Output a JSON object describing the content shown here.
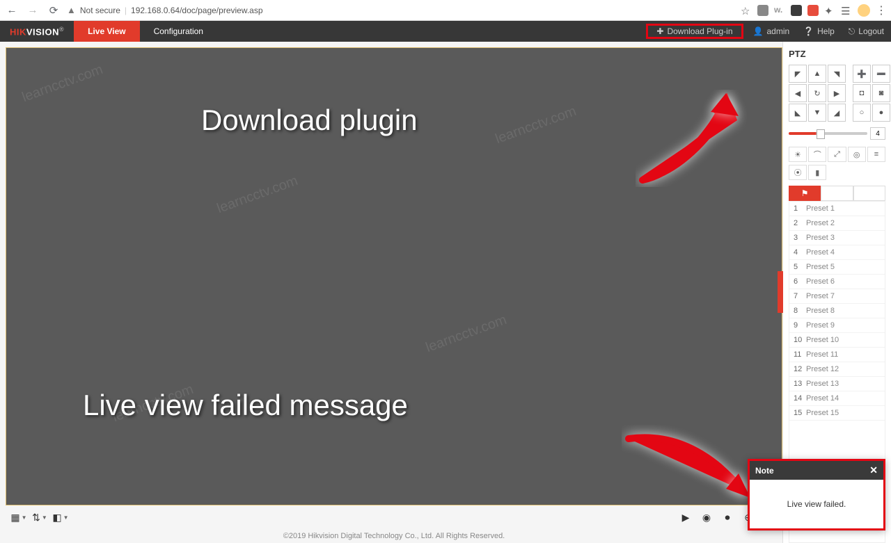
{
  "browser": {
    "security_label": "Not secure",
    "url": "192.168.0.64/doc/page/preview.asp"
  },
  "brand": {
    "part1": "HIK",
    "part2": "VISION",
    "reg": "®"
  },
  "nav": {
    "live_view": "Live View",
    "configuration": "Configuration"
  },
  "top_links": {
    "download": "Download Plug-in",
    "admin": "admin",
    "help": "Help",
    "logout": "Logout"
  },
  "ptz": {
    "title": "PTZ",
    "speed": "4",
    "presets": [
      {
        "n": "1",
        "name": "Preset 1"
      },
      {
        "n": "2",
        "name": "Preset 2"
      },
      {
        "n": "3",
        "name": "Preset 3"
      },
      {
        "n": "4",
        "name": "Preset 4"
      },
      {
        "n": "5",
        "name": "Preset 5"
      },
      {
        "n": "6",
        "name": "Preset 6"
      },
      {
        "n": "7",
        "name": "Preset 7"
      },
      {
        "n": "8",
        "name": "Preset 8"
      },
      {
        "n": "9",
        "name": "Preset 9"
      },
      {
        "n": "10",
        "name": "Preset 10"
      },
      {
        "n": "11",
        "name": "Preset 11"
      },
      {
        "n": "12",
        "name": "Preset 12"
      },
      {
        "n": "13",
        "name": "Preset 13"
      },
      {
        "n": "14",
        "name": "Preset 14"
      },
      {
        "n": "15",
        "name": "Preset 15"
      }
    ]
  },
  "annotations": {
    "download_plugin": "Download plugin",
    "live_view_failed_message": "Live view failed message"
  },
  "note": {
    "title": "Note",
    "body": "Live view failed."
  },
  "footer": "©2019 Hikvision Digital Technology Co., Ltd. All Rights Reserved.",
  "watermark": "learncctv.com"
}
